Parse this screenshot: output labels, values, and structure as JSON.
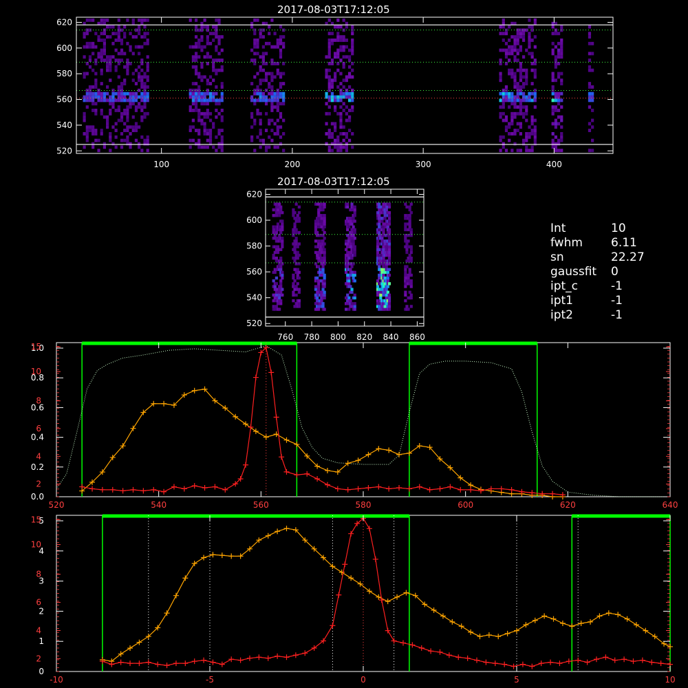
{
  "titles": {
    "top": "2017-08-03T17:12:05",
    "middle": "2017-08-03T17:12:05"
  },
  "info": [
    {
      "key": "Int",
      "value": "10"
    },
    {
      "key": "fwhm",
      "value": "6.11"
    },
    {
      "key": "sn",
      "value": "22.27"
    },
    {
      "key": "gaussfit",
      "value": "0"
    },
    {
      "key": "ipt_c",
      "value": "-1"
    },
    {
      "key": "ipt1",
      "value": "-1"
    },
    {
      "key": "ipt2",
      "value": "-1"
    }
  ],
  "colors": {
    "background": "#000000",
    "axis": "#ffffff",
    "orange_series": "#ffa500",
    "red_series": "#ff2020",
    "green_box": "#00ff00",
    "dotted_profile": "#ccffcc"
  },
  "chart_data": [
    {
      "type": "heatmap",
      "name": "top-spectrogram",
      "title": "2017-08-03T17:12:05",
      "xlim": [
        35,
        445
      ],
      "ylim": [
        518,
        624
      ],
      "xticks": [
        100,
        200,
        300,
        400
      ],
      "yticks": [
        520,
        540,
        560,
        580,
        600,
        620
      ],
      "white_hlines": [
        618,
        525
      ],
      "dotted_hlines": [
        {
          "y": 614,
          "color": "green"
        },
        {
          "y": 589,
          "color": "green"
        },
        {
          "y": 567,
          "color": "green"
        },
        {
          "y": 561,
          "color": "red"
        }
      ],
      "bright_row": 560,
      "columns": [
        {
          "x0": 40,
          "x1": 90,
          "level": 0.55
        },
        {
          "x0": 121,
          "x1": 147,
          "level": 0.6
        },
        {
          "x0": 168,
          "x1": 194,
          "level": 0.6
        },
        {
          "x0": 225,
          "x1": 246,
          "level": 0.8
        },
        {
          "x0": 358,
          "x1": 385,
          "level": 0.75
        },
        {
          "x0": 398,
          "x1": 405,
          "level": 0.9
        },
        {
          "x0": 426,
          "x1": 430,
          "level": 0.5
        }
      ]
    },
    {
      "type": "heatmap",
      "name": "middle-spectrogram",
      "title": "2017-08-03T17:12:05",
      "xlim": [
        745,
        865
      ],
      "ylim": [
        518,
        624
      ],
      "xticks": [
        760,
        780,
        800,
        820,
        840,
        860
      ],
      "yticks": [
        520,
        540,
        560,
        580,
        600,
        620
      ],
      "white_hlines": [
        618,
        525
      ],
      "dotted_hlines": [
        {
          "y": 614,
          "color": "green"
        },
        {
          "y": 589,
          "color": "green"
        },
        {
          "y": 567,
          "color": "green"
        }
      ],
      "streaks": [
        {
          "x0": 750,
          "x1": 757,
          "level": 0.5
        },
        {
          "x0": 765,
          "x1": 770,
          "level": 0.3
        },
        {
          "x0": 782,
          "x1": 789,
          "level": 0.6
        },
        {
          "x0": 805,
          "x1": 812,
          "level": 0.75
        },
        {
          "x0": 829,
          "x1": 838,
          "level": 1.0
        },
        {
          "x0": 850,
          "x1": 855,
          "level": 0.3
        }
      ]
    },
    {
      "type": "line",
      "name": "wavelength-profile",
      "xlim": [
        520,
        640
      ],
      "xticks": [
        520,
        540,
        560,
        580,
        600,
        620,
        640
      ],
      "left_yticks_white": [
        "0.0",
        "0.2",
        "0.4",
        "0.6",
        "0.8",
        "1.0"
      ],
      "left_yticks_red": [
        "2",
        "4",
        "6",
        "8",
        "10",
        "15"
      ],
      "green_boxes": [
        [
          525,
          567
        ],
        [
          589,
          614
        ]
      ],
      "dotted_vline": 561,
      "filter_profile": {
        "x": [
          520,
          522,
          524,
          526,
          528,
          530,
          533,
          537,
          542,
          547,
          552,
          557,
          561,
          564,
          566,
          568,
          570,
          572,
          575,
          580,
          585,
          587,
          589,
          591,
          593,
          596,
          600,
          605,
          609,
          611,
          613,
          615,
          617,
          620,
          625,
          630,
          640
        ],
        "y": [
          0.05,
          0.15,
          0.42,
          0.7,
          0.82,
          0.86,
          0.9,
          0.92,
          0.95,
          0.96,
          0.95,
          0.94,
          0.98,
          0.92,
          0.7,
          0.45,
          0.32,
          0.25,
          0.22,
          0.21,
          0.21,
          0.27,
          0.55,
          0.8,
          0.86,
          0.88,
          0.88,
          0.87,
          0.83,
          0.68,
          0.42,
          0.2,
          0.1,
          0.03,
          0.01,
          0.0,
          0.0
        ]
      },
      "series": [
        {
          "name": "orange",
          "x": [
            525,
            527,
            529,
            531,
            533,
            535,
            537,
            539,
            541,
            543,
            545,
            547,
            549,
            551,
            553,
            555,
            557,
            559,
            561,
            563,
            565,
            567,
            569,
            571,
            573,
            575,
            577,
            579,
            581,
            583,
            585,
            587,
            589,
            591,
            593,
            595,
            597,
            599,
            601,
            603,
            605,
            607,
            609,
            611,
            613,
            615,
            617,
            619
          ],
          "y": [
            0.04,
            0.1,
            0.17,
            0.27,
            0.35,
            0.47,
            0.58,
            0.64,
            0.64,
            0.63,
            0.7,
            0.73,
            0.74,
            0.66,
            0.61,
            0.55,
            0.5,
            0.45,
            0.41,
            0.43,
            0.39,
            0.36,
            0.28,
            0.21,
            0.18,
            0.17,
            0.23,
            0.25,
            0.29,
            0.33,
            0.32,
            0.29,
            0.3,
            0.35,
            0.34,
            0.26,
            0.2,
            0.13,
            0.08,
            0.05,
            0.04,
            0.03,
            0.02,
            0.02,
            0.01,
            0.01,
            0.0,
            0.0
          ],
          "ylim": [
            0,
            1.06
          ]
        },
        {
          "name": "red",
          "x": [
            525,
            527,
            529,
            531,
            533,
            535,
            537,
            539,
            541,
            543,
            545,
            547,
            549,
            551,
            553,
            555,
            556,
            557,
            558,
            559,
            560,
            561,
            562,
            563,
            564,
            565,
            567,
            569,
            571,
            573,
            575,
            577,
            579,
            581,
            583,
            585,
            587,
            589,
            591,
            593,
            595,
            597,
            599,
            601,
            603,
            605,
            607,
            609,
            611,
            613,
            615,
            617,
            619
          ],
          "y": [
            1.0,
            0.8,
            0.7,
            0.7,
            0.6,
            0.7,
            0.6,
            0.7,
            0.5,
            1.0,
            0.8,
            1.1,
            0.9,
            1.0,
            0.7,
            1.3,
            1.8,
            3.2,
            7.0,
            12.0,
            14.5,
            15.0,
            12.5,
            8.0,
            4.0,
            2.5,
            2.2,
            2.3,
            1.8,
            1.2,
            0.8,
            0.7,
            0.8,
            0.9,
            1.0,
            0.8,
            0.9,
            0.8,
            1.0,
            0.7,
            0.8,
            1.0,
            0.7,
            0.7,
            0.6,
            0.8,
            0.8,
            0.7,
            0.5,
            0.4,
            0.3,
            0.3,
            0.2
          ],
          "ylim": [
            0,
            15.5
          ]
        }
      ]
    },
    {
      "type": "line",
      "name": "velocity-profile",
      "xlim": [
        -10,
        10
      ],
      "xticks": [
        -10,
        -5,
        0,
        5,
        10
      ],
      "left_yticks_white": [
        "0",
        "1",
        "2",
        "3",
        "4",
        "5"
      ],
      "left_yticks_red": [
        "2",
        "4",
        "6",
        "8",
        "10",
        "15"
      ],
      "green_boxes": [
        [
          -8.5,
          1.5
        ],
        [
          6.8,
          10
        ]
      ],
      "dotted_vlines": [
        -7,
        -5,
        -1,
        1,
        5,
        7
      ],
      "dotted_vline_red": 0,
      "series": [
        {
          "name": "orange",
          "x": [
            -8.5,
            -8.2,
            -7.9,
            -7.6,
            -7.3,
            -7.0,
            -6.7,
            -6.4,
            -6.1,
            -5.8,
            -5.5,
            -5.2,
            -4.9,
            -4.6,
            -4.3,
            -4.0,
            -3.7,
            -3.4,
            -3.1,
            -2.8,
            -2.5,
            -2.2,
            -1.9,
            -1.6,
            -1.3,
            -1.0,
            -0.7,
            -0.4,
            -0.1,
            0.2,
            0.5,
            0.8,
            1.1,
            1.4,
            1.7,
            2.0,
            2.3,
            2.6,
            2.9,
            3.2,
            3.5,
            3.8,
            4.1,
            4.4,
            4.7,
            5.0,
            5.3,
            5.6,
            5.9,
            6.2,
            6.5,
            6.8,
            7.1,
            7.4,
            7.7,
            8.0,
            8.3,
            8.6,
            8.9,
            9.2,
            9.5,
            9.8,
            10.0
          ],
          "y": [
            0.4,
            0.35,
            0.6,
            0.8,
            1.0,
            1.2,
            1.5,
            2.0,
            2.6,
            3.2,
            3.7,
            3.9,
            4.0,
            3.98,
            3.95,
            3.95,
            4.2,
            4.5,
            4.65,
            4.8,
            4.9,
            4.85,
            4.5,
            4.2,
            3.9,
            3.6,
            3.4,
            3.2,
            3.0,
            2.75,
            2.55,
            2.4,
            2.55,
            2.7,
            2.6,
            2.3,
            2.1,
            1.9,
            1.7,
            1.55,
            1.35,
            1.2,
            1.25,
            1.2,
            1.3,
            1.4,
            1.6,
            1.75,
            1.9,
            1.8,
            1.65,
            1.55,
            1.65,
            1.7,
            1.9,
            2.0,
            1.95,
            1.8,
            1.6,
            1.4,
            1.2,
            0.95,
            0.85
          ],
          "ylim": [
            0,
            5.35
          ]
        },
        {
          "name": "red",
          "x": [
            -8.5,
            -8.2,
            -7.9,
            -7.6,
            -7.3,
            -7.0,
            -6.7,
            -6.4,
            -6.1,
            -5.8,
            -5.5,
            -5.2,
            -4.9,
            -4.6,
            -4.3,
            -4.0,
            -3.7,
            -3.4,
            -3.1,
            -2.8,
            -2.5,
            -2.2,
            -1.9,
            -1.6,
            -1.3,
            -1.0,
            -0.8,
            -0.6,
            -0.4,
            -0.2,
            0.0,
            0.2,
            0.4,
            0.6,
            0.8,
            1.0,
            1.3,
            1.6,
            1.9,
            2.2,
            2.5,
            2.8,
            3.1,
            3.4,
            3.7,
            4.0,
            4.3,
            4.6,
            4.9,
            5.2,
            5.5,
            5.8,
            6.1,
            6.4,
            6.7,
            7.0,
            7.3,
            7.6,
            7.9,
            8.2,
            8.5,
            8.8,
            9.1,
            9.4,
            9.7,
            10.0
          ],
          "y": [
            1.0,
            0.7,
            0.9,
            0.8,
            0.8,
            0.9,
            0.7,
            0.6,
            0.8,
            0.8,
            1.0,
            1.1,
            0.9,
            0.7,
            1.2,
            1.1,
            1.3,
            1.4,
            1.3,
            1.5,
            1.4,
            1.6,
            1.8,
            2.3,
            3.0,
            4.5,
            7.5,
            10.5,
            13.5,
            14.5,
            15.0,
            14.0,
            11.0,
            7.0,
            4.0,
            3.0,
            2.8,
            2.6,
            2.3,
            2.0,
            1.9,
            1.6,
            1.4,
            1.3,
            1.1,
            0.9,
            0.8,
            0.7,
            0.5,
            0.7,
            0.5,
            0.8,
            0.9,
            0.8,
            1.0,
            1.1,
            0.9,
            1.2,
            1.4,
            1.1,
            1.2,
            1.0,
            1.1,
            0.9,
            0.8,
            0.7
          ],
          "ylim": [
            0,
            15.3
          ]
        }
      ]
    }
  ]
}
